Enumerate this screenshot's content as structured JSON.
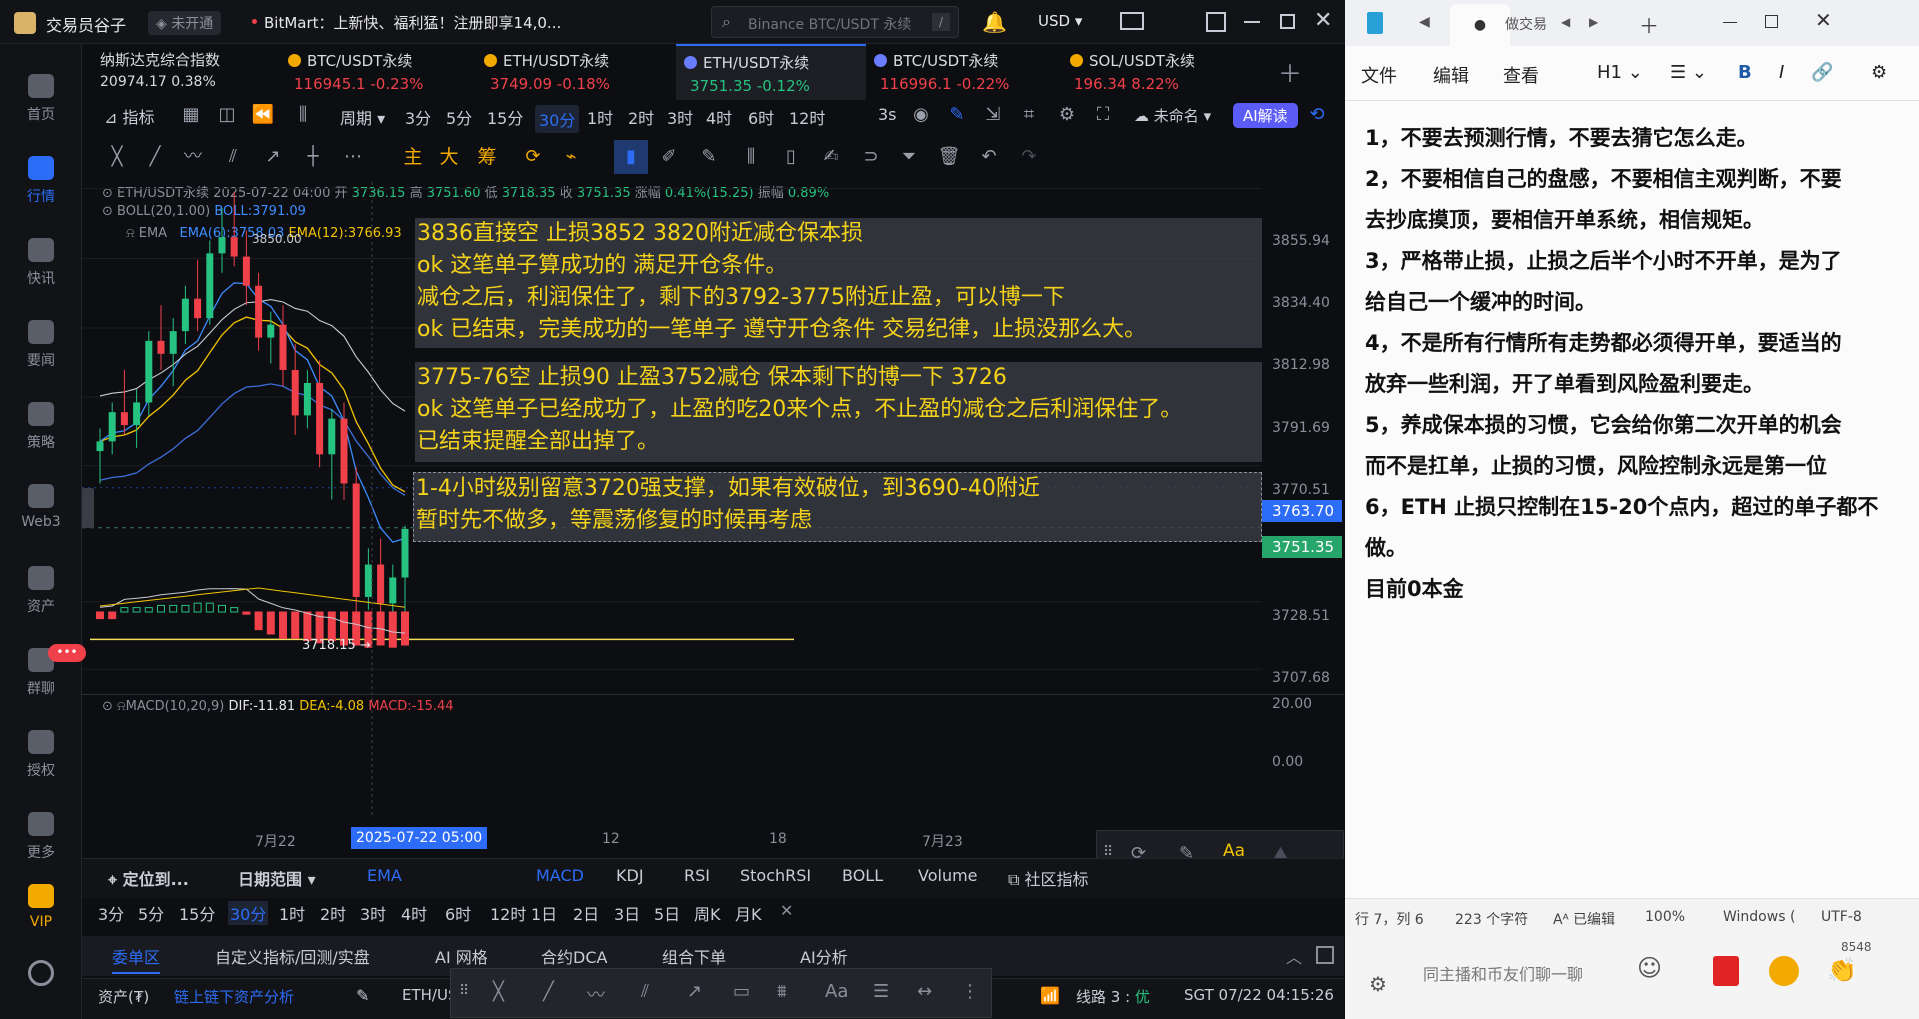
{
  "app": {
    "title": "交易员谷子",
    "badge": "未开通",
    "notice": "BitMart：上新快、福利猛！注册即享14,0...",
    "search_placeholder": "Binance BTC/USDT 永续",
    "search_key": "/",
    "currency": "USD"
  },
  "index": {
    "name": "纳斯达克综合指数",
    "value": "20974.17",
    "change": "0.38%"
  },
  "tickers": [
    {
      "name": "BTC/USDT永续",
      "price": "116945.1",
      "change": "-0.23%"
    },
    {
      "name": "ETH/USDT永续",
      "price": "3749.09",
      "change": "-0.18%"
    },
    {
      "name": "ETH/USDT永续",
      "price": "3751.35",
      "change": "-0.12%"
    },
    {
      "name": "BTC/USDT永续",
      "price": "116996.1",
      "change": "-0.22%"
    },
    {
      "name": "SOL/USDT永续",
      "price": "196.34",
      "change": "8.22%"
    }
  ],
  "sidebar": [
    {
      "label": "首页",
      "icon": "home-icon"
    },
    {
      "label": "行情",
      "icon": "chart-bars-icon"
    },
    {
      "label": "快讯",
      "icon": "flash-news-icon"
    },
    {
      "label": "要闻",
      "icon": "newspaper-icon"
    },
    {
      "label": "策略",
      "icon": "robot-icon"
    },
    {
      "label": "Web3",
      "icon": "web3-icon"
    },
    {
      "label": "资产",
      "icon": "wallet-icon"
    },
    {
      "label": "群聊",
      "icon": "chat-icon"
    },
    {
      "label": "授权",
      "icon": "key-icon"
    },
    {
      "label": "更多",
      "icon": "grid-icon"
    },
    {
      "label": "VIP",
      "icon": "diamond-icon"
    }
  ],
  "toolbar": {
    "indicators": "指标",
    "period": "周期",
    "intervals": [
      "3分",
      "5分",
      "15分",
      "30分",
      "1时",
      "2时",
      "3时",
      "4时",
      "6时",
      "12时"
    ],
    "refresh": "3s",
    "unnamed": "未命名",
    "ai": "AI解读"
  },
  "drawtools": {
    "zhu": "主",
    "da": "大",
    "chou": "筹"
  },
  "info": {
    "symbol": "ETH/USDT永续",
    "time": "2025-07-22 04:00",
    "open_l": "开",
    "open": "3736.15",
    "high_l": "高",
    "high": "3751.60",
    "low_l": "低",
    "low": "3718.35",
    "close_l": "收",
    "close": "3751.35",
    "chg_l": "涨幅",
    "chg": "0.41%(15.25)",
    "amp_l": "振幅",
    "amp": "0.89%"
  },
  "boll": {
    "label": "BOLL(20,1.00)",
    "value": "BOLL:3791.09"
  },
  "ema": {
    "label": "EMA",
    "v1": "EMA(6):3758.03",
    "v2": "EMA(12):3766.93",
    "top": "3850.00"
  },
  "annotations": [
    [
      "3836直接空 止损3852 3820附近减仓保本损",
      "ok 这笔单子算成功的 满足开仓条件。",
      "减仓之后，利润保住了，剩下的3792-3775附近止盈，可以博一下",
      "ok 已结束，完美成功的一笔单子 遵守开仓条件 交易纪律，止损没那么大。"
    ],
    [
      "3775-76空 止损90 止盈3752减仓 保本剩下的博一下 3726",
      "ok 这笔单子已经成功了，止盈的吃20来个点，不止盈的减仓之后利润保住了。",
      "已结束提醒全部出掉了。"
    ],
    [
      "1-4小时级别留意3720强支撑，如果有效破位，到3690-40附近",
      "暂时先不做多，等震荡修复的时候再考虑"
    ]
  ],
  "yaxis": [
    "3855.94",
    "3834.40",
    "3812.98",
    "3791.69",
    "3770.51",
    "3728.51",
    "3707.68"
  ],
  "price_tags": {
    "boll": "3763.70",
    "last": "3751.35"
  },
  "low_label": "3718.15",
  "macd": {
    "label": "MACD(10,20,9)",
    "dif": "DIF:-11.81",
    "dea": "DEA:-4.08",
    "macd": "MACD:-15.44",
    "y1": "20.00",
    "y2": "0.00"
  },
  "xaxis": {
    "d1": "7月22",
    "cursor": "2025-07-22 05:00",
    "d2": "12",
    "d3": "18",
    "d4": "7月23"
  },
  "indicator_bar": {
    "locate": "定位到...",
    "range": "日期范围",
    "ema": "EMA",
    "tabs": [
      "MACD",
      "KDJ",
      "RSI",
      "StochRSI",
      "BOLL",
      "Volume"
    ],
    "community": "社区指标"
  },
  "interval_bar": [
    "3分",
    "5分",
    "15分",
    "30分",
    "1时",
    "2时",
    "3时",
    "4时",
    "6时",
    "12时",
    "1日",
    "2日",
    "3日",
    "5日",
    "周K",
    "月K"
  ],
  "bottom_tabs": [
    "委单区",
    "自定义指标/回测/实盘",
    "AI 网格",
    "合约DCA",
    "组合下单",
    "AI分析"
  ],
  "status": {
    "assets": "资产(₮)",
    "analysis": "链上链下资产分析",
    "symbol": "ETH/US",
    "line": "线路 3 :",
    "line_q": "优",
    "time": "SGT 07/22 04:15:26"
  },
  "notepad": {
    "tab": "做交易",
    "menu": [
      "文件",
      "编辑",
      "查看"
    ],
    "heading": "H1",
    "lines": [
      "1，不要去预测行情，不要去猜它怎么走。",
      "2，不要相信自己的盘感，不要相信主观判断，不要",
      "去抄底摸顶，要相信开单系统，相信规矩。",
      "3，严格带止损，止损之后半个小时不开单，是为了",
      "给自己一个缓冲的时间。",
      "4，不是所有行情所有走势都必须得开单，要适当的",
      "放弃一些利润，开了单看到风险盈利要走。",
      "5，养成保本损的习惯，它会给你第二次开单的机会",
      "而不是扛单，止损的习惯，风险控制永远是第一位",
      "6，ETH 止损只控制在15-20个点内，超过的单子都不",
      "做。",
      "目前0本金"
    ],
    "status": {
      "pos": "行 7，列 6",
      "chars": "223 个字符",
      "edited": "已编辑",
      "zoom": "100%",
      "eol": "Windows (",
      "enc": "UTF-8"
    }
  },
  "chat": {
    "placeholder": "同主播和币友们聊一聊",
    "count": "8548"
  },
  "colors": {
    "up": "#26c281",
    "down": "#f0404a",
    "accent": "#2d6cf6",
    "annotation": "#f5d31a"
  },
  "candles": [
    [
      3775,
      3782,
      3765,
      3778
    ],
    [
      3778,
      3790,
      3774,
      3787
    ],
    [
      3787,
      3800,
      3780,
      3783
    ],
    [
      3783,
      3794,
      3776,
      3790
    ],
    [
      3790,
      3812,
      3786,
      3809
    ],
    [
      3809,
      3820,
      3800,
      3805
    ],
    [
      3805,
      3816,
      3795,
      3812
    ],
    [
      3812,
      3826,
      3808,
      3822
    ],
    [
      3822,
      3834,
      3812,
      3816
    ],
    [
      3816,
      3840,
      3814,
      3836
    ],
    [
      3836,
      3850,
      3830,
      3841
    ],
    [
      3841,
      3855,
      3832,
      3835
    ],
    [
      3835,
      3843,
      3820,
      3826
    ],
    [
      3826,
      3830,
      3806,
      3810
    ],
    [
      3810,
      3818,
      3802,
      3814
    ],
    [
      3814,
      3820,
      3795,
      3800
    ],
    [
      3800,
      3808,
      3780,
      3786
    ],
    [
      3786,
      3800,
      3782,
      3796
    ],
    [
      3796,
      3803,
      3770,
      3774
    ],
    [
      3774,
      3788,
      3760,
      3785
    ],
    [
      3785,
      3790,
      3760,
      3765
    ],
    [
      3765,
      3770,
      3724,
      3730
    ],
    [
      3730,
      3745,
      3726,
      3740
    ],
    [
      3740,
      3748,
      3722,
      3728
    ],
    [
      3728,
      3740,
      3718,
      3736
    ],
    [
      3736,
      3752,
      3718,
      3751
    ]
  ],
  "macd_hist": [
    -3,
    -3,
    2,
    2,
    2,
    3,
    3,
    3,
    4,
    4,
    3,
    2,
    -1,
    -8,
    -10,
    -12,
    -12,
    -13,
    -14,
    -13,
    -15,
    -15,
    -16,
    -15,
    -16,
    -15
  ]
}
